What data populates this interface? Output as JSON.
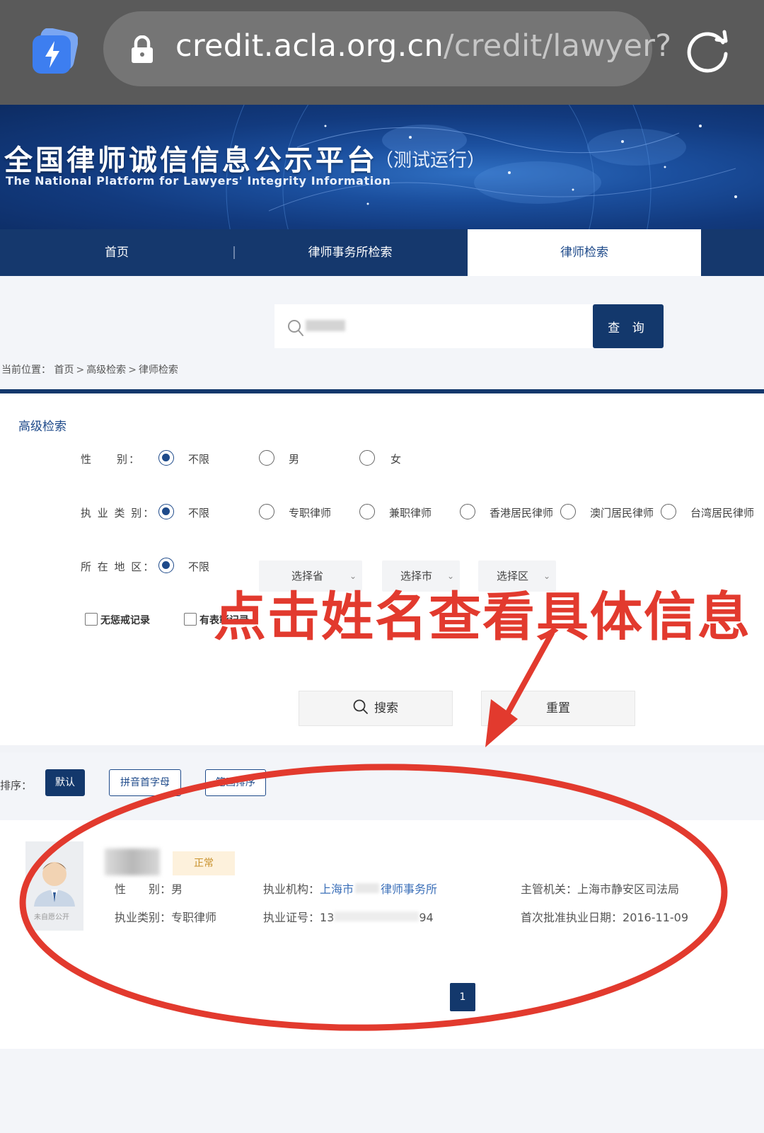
{
  "browser": {
    "url_domain": "credit.acla.org.cn",
    "url_path": "/credit/lawyer?",
    "icons": [
      "lightning-app-icon",
      "lock-icon",
      "reload-icon"
    ]
  },
  "banner": {
    "title": "全国律师诚信信息公示平台",
    "subtitle": "（测试运行）",
    "english": "The National Platform for Lawyers' Integrity Information"
  },
  "nav": {
    "home": "首页",
    "firm_search": "律师事务所检索",
    "lawyer_search": "律师检索"
  },
  "search": {
    "button_label": "查 询"
  },
  "breadcrumb": {
    "prefix": "当前位置：",
    "home": "首页",
    "advanced": "高级检索",
    "current": "律师检索",
    "separator": ">"
  },
  "advanced": {
    "title": "高级检索",
    "gender": {
      "label": "性　　别：",
      "options": [
        "不限",
        "男",
        "女"
      ],
      "selected": "不限"
    },
    "practice_type": {
      "label": "执 业 类 别：",
      "options": [
        "不限",
        "专职律师",
        "兼职律师",
        "香港居民律师",
        "澳门居民律师",
        "台湾居民律师"
      ],
      "selected": "不限"
    },
    "region": {
      "label": "所 在 地 区：",
      "option": "不限",
      "province": "选择省",
      "city": "选择市",
      "district": "选择区"
    },
    "checkboxes": [
      "无惩戒记录",
      "有表彰记录"
    ],
    "search_button": "搜索",
    "reset_button": "重置"
  },
  "sort": {
    "label": "排序：",
    "options": [
      "默认",
      "拼音首字母",
      "笔画排序"
    ],
    "active": "默认"
  },
  "result": {
    "avatar_caption": "未自愿公开",
    "status": "正常",
    "gender_label": "性　　别：",
    "gender_value": "男",
    "practice_type_label": "执业类别：",
    "practice_type_value": "专职律师",
    "org_label": "执业机构：",
    "org_prefix": "上海市",
    "org_suffix": "律师事务所",
    "license_label": "执业证号：",
    "license_prefix": "13",
    "license_suffix": "94",
    "authority_label": "主管机关：",
    "authority_value": "上海市静安区司法局",
    "first_approval_label": "首次批准执业日期：",
    "first_approval_value": "2016-11-09"
  },
  "pagination": {
    "current": "1"
  },
  "annotation": {
    "text": "点击姓名查看具体信息",
    "color": "#e23a2e"
  },
  "colors": {
    "primary_navy": "#13386c",
    "link_blue": "#3b6fb8",
    "status_bg": "#fdf1dc",
    "status_text": "#c8912c"
  }
}
